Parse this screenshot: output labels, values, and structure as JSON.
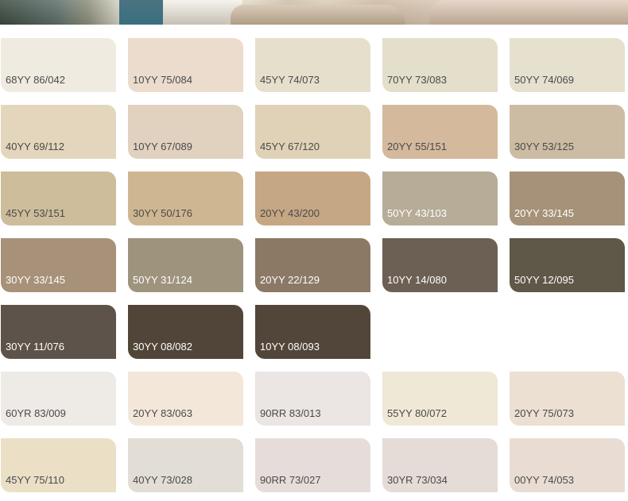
{
  "swatches": [
    {
      "code": "68YY 86/042",
      "color": "#efebe0",
      "text_color": "#4a4a4a"
    },
    {
      "code": "10YY 75/084",
      "color": "#ebdccd",
      "text_color": "#4a4a4a"
    },
    {
      "code": "45YY 74/073",
      "color": "#e6dfcc",
      "text_color": "#4a4a4a"
    },
    {
      "code": "70YY 73/083",
      "color": "#e3dfca",
      "text_color": "#4a4a4a"
    },
    {
      "code": "50YY 74/069",
      "color": "#e6e0cf",
      "text_color": "#4a4a4a"
    },
    {
      "code": "40YY 69/112",
      "color": "#e3d6bc",
      "text_color": "#4a4a4a"
    },
    {
      "code": "10YY 67/089",
      "color": "#e0d2bf",
      "text_color": "#4a4a4a"
    },
    {
      "code": "45YY 67/120",
      "color": "#dfd2b6",
      "text_color": "#4a4a4a"
    },
    {
      "code": "20YY 55/151",
      "color": "#d4b99d",
      "text_color": "#4a4a4a"
    },
    {
      "code": "30YY 53/125",
      "color": "#ccbca3",
      "text_color": "#4a4a4a"
    },
    {
      "code": "45YY 53/151",
      "color": "#cdbd9b",
      "text_color": "#4a4a4a"
    },
    {
      "code": "30YY 50/176",
      "color": "#cfb693",
      "text_color": "#4a4a4a"
    },
    {
      "code": "20YY 43/200",
      "color": "#c5a784",
      "text_color": "#4a4a4a"
    },
    {
      "code": "50YY 43/103",
      "color": "#b6ac97",
      "text_color": "#ffffff"
    },
    {
      "code": "20YY 33/145",
      "color": "#a69279",
      "text_color": "#ffffff"
    },
    {
      "code": "30YY 33/145",
      "color": "#a89179",
      "text_color": "#ffffff"
    },
    {
      "code": "50YY 31/124",
      "color": "#9e937d",
      "text_color": "#ffffff"
    },
    {
      "code": "20YY 22/129",
      "color": "#8b7865",
      "text_color": "#ffffff"
    },
    {
      "code": "10YY 14/080",
      "color": "#6c6054",
      "text_color": "#ffffff"
    },
    {
      "code": "50YY 12/095",
      "color": "#5f5747",
      "text_color": "#ffffff"
    },
    {
      "code": "30YY 11/076",
      "color": "#5d534a",
      "text_color": "#ffffff"
    },
    {
      "code": "30YY 08/082",
      "color": "#504538",
      "text_color": "#ffffff"
    },
    {
      "code": "10YY 08/093",
      "color": "#52463a",
      "text_color": "#ffffff"
    },
    {
      "code": "60YR 83/009",
      "color": "#eeeae6",
      "text_color": "#4a4a4a"
    },
    {
      "code": "20YY 83/063",
      "color": "#f3e7da",
      "text_color": "#4a4a4a"
    },
    {
      "code": "90RR 83/013",
      "color": "#ebe5e3",
      "text_color": "#4a4a4a"
    },
    {
      "code": "55YY 80/072",
      "color": "#efe8d7",
      "text_color": "#4a4a4a"
    },
    {
      "code": "20YY 75/073",
      "color": "#ece0d2",
      "text_color": "#4a4a4a"
    },
    {
      "code": "45YY 75/110",
      "color": "#ebe0c6",
      "text_color": "#4a4a4a"
    },
    {
      "code": "40YY 73/028",
      "color": "#e2ded6",
      "text_color": "#4a4a4a"
    },
    {
      "code": "90RR 73/027",
      "color": "#e6ddda",
      "text_color": "#4a4a4a"
    },
    {
      "code": "30YR 73/034",
      "color": "#e5dcd7",
      "text_color": "#4a4a4a"
    },
    {
      "code": "00YY 74/053",
      "color": "#e9ddd3",
      "text_color": "#4a4a4a"
    }
  ]
}
